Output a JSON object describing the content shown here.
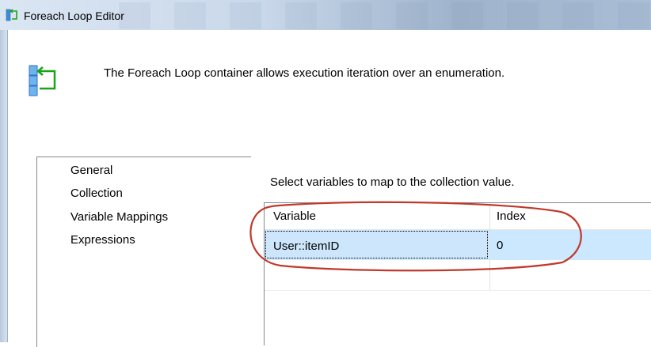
{
  "window": {
    "title": "Foreach Loop Editor"
  },
  "header": {
    "description": "The Foreach Loop container allows execution iteration over an enumeration."
  },
  "nav": {
    "items": [
      {
        "label": "General"
      },
      {
        "label": "Collection"
      },
      {
        "label": "Variable Mappings"
      },
      {
        "label": "Expressions"
      }
    ]
  },
  "mappings": {
    "instruction": "Select variables to map to the collection value.",
    "columns": [
      "Variable",
      "Index"
    ],
    "rows": [
      {
        "variable": "User::itemID",
        "index": "0"
      }
    ]
  },
  "colors": {
    "selected_row": "#cce8ff",
    "annotation_circle": "#c0392b",
    "icon_blue": "#2e8be6",
    "icon_green": "#1aa31a"
  }
}
